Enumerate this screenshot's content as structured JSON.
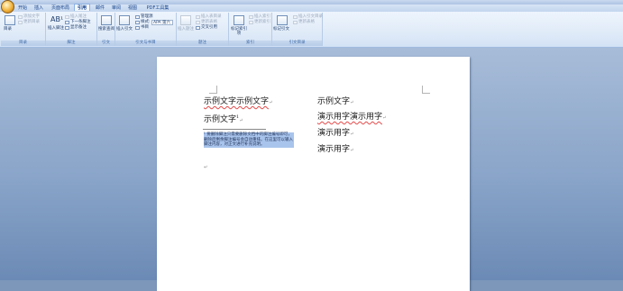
{
  "tabs": [
    {
      "label": "开始"
    },
    {
      "label": "插入"
    },
    {
      "label": "页面布局"
    },
    {
      "label": "引用"
    },
    {
      "label": "邮件"
    },
    {
      "label": "审阅"
    },
    {
      "label": "视图"
    },
    {
      "label": "PDF工具集"
    }
  ],
  "active_tab": "引用",
  "ribbon": {
    "toc": {
      "label": "目录",
      "big_button": "目录",
      "add_text": "添加文字",
      "update_toc": "更新目录"
    },
    "footnotes": {
      "label": "脚注",
      "insert_footnote": "插入脚注",
      "insert_endnote": "插入尾注",
      "next_footnote": "下一条脚注",
      "show_notes": "显示备注"
    },
    "research": {
      "label": "引文",
      "button": "搜索查阅"
    },
    "citations": {
      "label": "引文与书目",
      "insert_citation": "插入引文",
      "manage_sources": "管理源",
      "style_label": "样式:",
      "style_value": "APA 第六",
      "bibliography": "书目"
    },
    "captions": {
      "label": "题注",
      "insert_caption": "插入题注",
      "insert_table_of_figures": "插入表目录",
      "update_table": "更新表格",
      "cross_reference": "交叉引用"
    },
    "index": {
      "label": "索引",
      "mark_entry": "标记索引项",
      "insert_index": "插入索引",
      "update_index": "更新索引"
    },
    "toa": {
      "label": "引文目录",
      "mark_citation": "标记引文",
      "insert_toa": "插入引文目录",
      "update_toa": "更新表格"
    }
  },
  "document": {
    "left_lines": [
      "示例文字示例文字",
      "示例文字"
    ],
    "footnote_ref": "1",
    "right_lines": [
      "示例文字",
      "演示用字演示用字",
      "演示用字",
      "演示用字"
    ],
    "footnote_text": "¹ 要删除脚注只需要删除文档中的脚注编号即可，删除后剩余脚注编号会自动重排。在这里可以输入脚注内容，对正文进行补充说明。"
  }
}
